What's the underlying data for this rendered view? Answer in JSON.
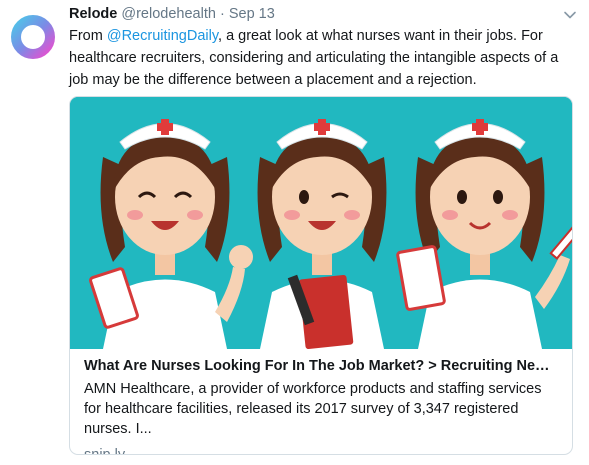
{
  "tweet": {
    "display_name": "Relode",
    "handle": "@relodehealth",
    "separator": "·",
    "date": "Sep 13",
    "text_before_mention": "From ",
    "mention": "@RecruitingDaily",
    "text_after_mention": ", a great look at what nurses want in their jobs. For healthcare recruiters, considering and articulating the intangible aspects of a job may be the difference between a placement and a rejection."
  },
  "card": {
    "title": "What Are Nurses Looking For In The Job Market? > Recruiting News ...",
    "description": "AMN Healthcare, a provider of workforce products and staffing services for healthcare facilities, released its 2017 survey of 3,347 registered nurses. I...",
    "domain": "snip.ly",
    "image_background": "#21b8c0"
  },
  "icons": {
    "avatar": "relode-ring-logo",
    "caret": "chevron-down-icon"
  },
  "colors": {
    "link": "#1b95e0",
    "muted": "#657786"
  }
}
